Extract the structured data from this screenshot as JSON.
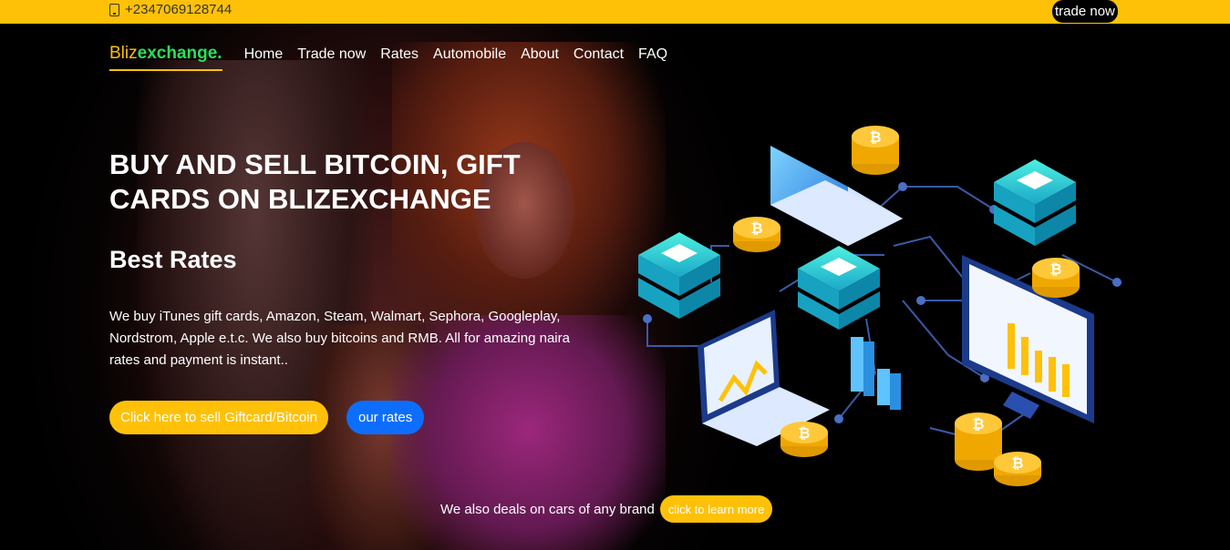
{
  "topbar": {
    "phone": "+2347069128744",
    "phone_icon": "phone-icon",
    "trade_label": "trade now"
  },
  "brand": {
    "part1": "Bliz",
    "part2": "exchange."
  },
  "nav": {
    "items": [
      "Home",
      "Trade now",
      "Rates",
      "Automobile",
      "About",
      "Contact",
      "FAQ"
    ]
  },
  "hero": {
    "headline": "BUY AND SELL BITCOIN, GIFT CARDS ON BLIZEXCHANGE",
    "subhead": "Best Rates",
    "description": "We buy iTunes gift cards, Amazon, Steam, Walmart, Sephora, Googleplay, Nordstrom, Apple e.t.c. We also buy bitcoins and RMB. All for amazing naira rates and payment is instant..",
    "sell_button": "Click here to sell Giftcard/Bitcoin",
    "rates_button": "our rates",
    "cars_text": "We also deals on cars of any brand",
    "learn_button": "click to learn more"
  },
  "illustration": {
    "coin_symbol": "₿"
  },
  "colors": {
    "accent": "#ffc107",
    "brand_green": "#28e05a",
    "primary_blue": "#0d6efd",
    "background": "#000000"
  }
}
